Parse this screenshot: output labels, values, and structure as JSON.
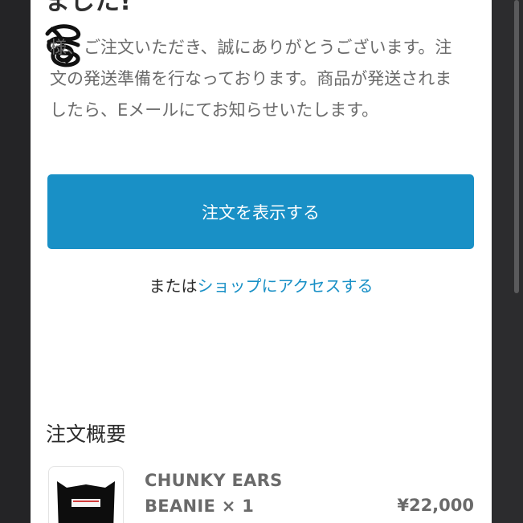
{
  "confirmation": {
    "heading_partial": "ました!",
    "message": "様、ご注文いただき、誠にありがとうございます。注文の発送準備を行なっております。商品が発送されましたら、Eメールにてお知らせいたします。"
  },
  "actions": {
    "view_order_label": "注文を表示する",
    "or_text": "または",
    "shop_link_label": "ショップにアクセスする"
  },
  "summary": {
    "title": "注文概要",
    "items": [
      {
        "name": "CHUNKY EARS BEANIE × 1",
        "price": "¥22,000"
      }
    ]
  },
  "colors": {
    "accent": "#1990c6",
    "text": "#2b2b2b",
    "muted": "#6b6b6b"
  }
}
